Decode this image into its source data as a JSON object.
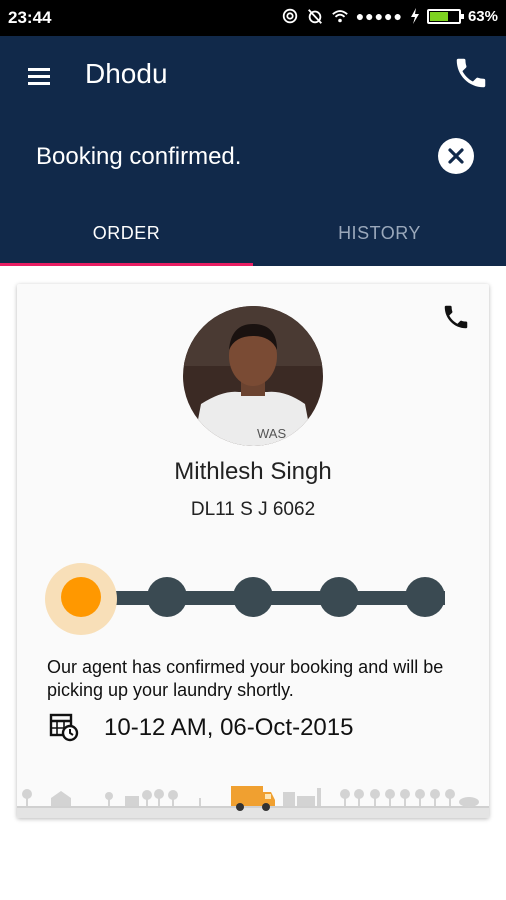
{
  "status_bar": {
    "time": "23:44",
    "signal_dots": "●●●●●",
    "battery_percent_label": "63%",
    "battery_level": 0.63
  },
  "app_bar": {
    "title": "Dhodu",
    "banner_text": "Booking confirmed.",
    "background_color": "#11294a"
  },
  "tabs": [
    {
      "label": "ORDER",
      "active": true
    },
    {
      "label": "HISTORY",
      "active": false
    }
  ],
  "tab_indicator_color": "#e91e63",
  "agent": {
    "name": "Mithlesh Singh",
    "vehicle_number": "DL11 S J 6062",
    "shirt_text": "WAS"
  },
  "progress": {
    "total_steps": 5,
    "current_step": 1,
    "active_color": "#ff9800",
    "inactive_color": "#3a4a52"
  },
  "status_message": "Our agent has confirmed your booking and will be picking up your laundry shortly.",
  "pickup_slot": "10-12 AM, 06-Oct-2015",
  "icons": {
    "menu": "hamburger-icon",
    "call": "phone-icon",
    "close": "close-circle-icon",
    "schedule": "calendar-clock-icon"
  }
}
